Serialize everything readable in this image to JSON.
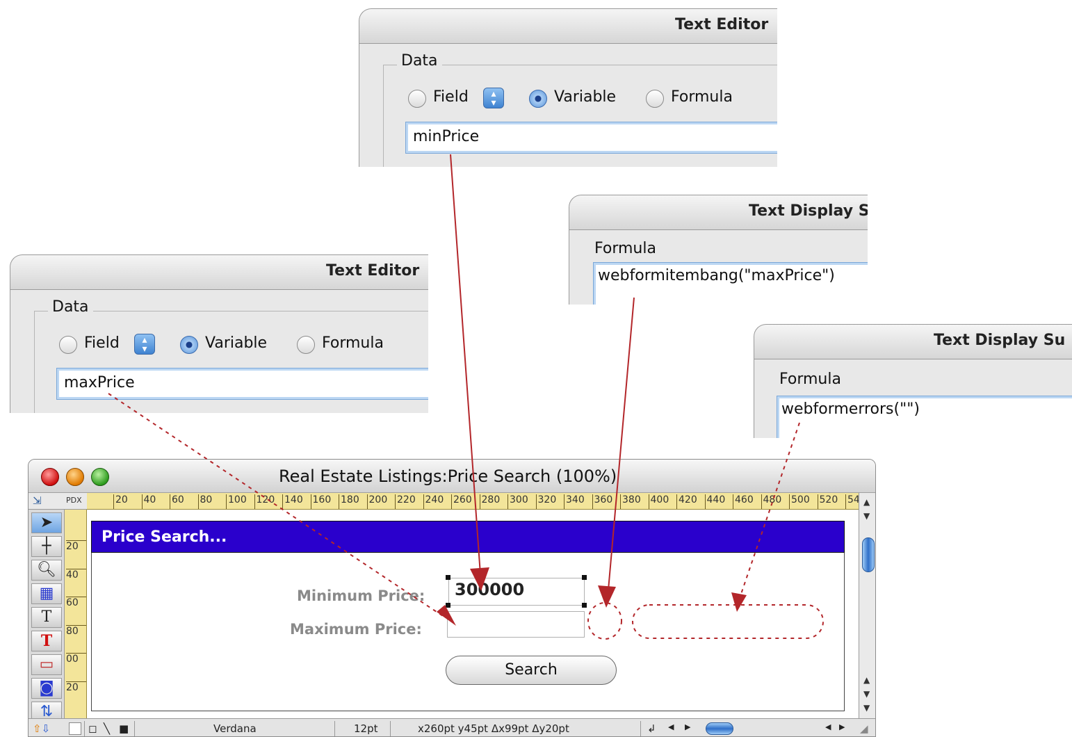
{
  "panel_min": {
    "title": "Text Editor",
    "group_label": "Data",
    "radio_field": "Field",
    "radio_variable": "Variable",
    "radio_formula": "Formula",
    "value": "minPrice"
  },
  "panel_max": {
    "title": "Text Editor",
    "group_label": "Data",
    "radio_field": "Field",
    "radio_variable": "Variable",
    "radio_formula": "Formula",
    "value": "maxPrice"
  },
  "panel_bang": {
    "title": "Text Display Su",
    "label": "Formula",
    "value": "webformitembang(\"maxPrice\")"
  },
  "panel_errors": {
    "title": "Text Display Su",
    "label": "Formula",
    "value": "webformerrors(\"\")"
  },
  "window": {
    "title": "Real Estate Listings:Price Search (100%)",
    "ruler_unit": "PDX",
    "ruler_top_ticks": [
      "20",
      "40",
      "60",
      "80",
      "100",
      "120",
      "140",
      "160",
      "180",
      "200",
      "220",
      "240",
      "260",
      "280",
      "300",
      "320",
      "340",
      "360",
      "380",
      "400",
      "420",
      "440",
      "460",
      "480",
      "500",
      "520",
      "54"
    ],
    "ruler_left_ticks": [
      "20",
      "40",
      "60",
      "80",
      "00",
      "20"
    ]
  },
  "form": {
    "header": "Price Search...",
    "min_label": "Minimum Price:",
    "min_value": "300000",
    "max_label": "Maximum Price:",
    "max_value": "",
    "search_button": "Search"
  },
  "statusbar": {
    "font": "Verdana",
    "size": "12pt",
    "coords": "x260pt y45pt Δx99pt Δy20pt"
  },
  "colors": {
    "header_bg": "#2a00cc",
    "arrow": "#b3262a",
    "ruler": "#f3e59a"
  }
}
